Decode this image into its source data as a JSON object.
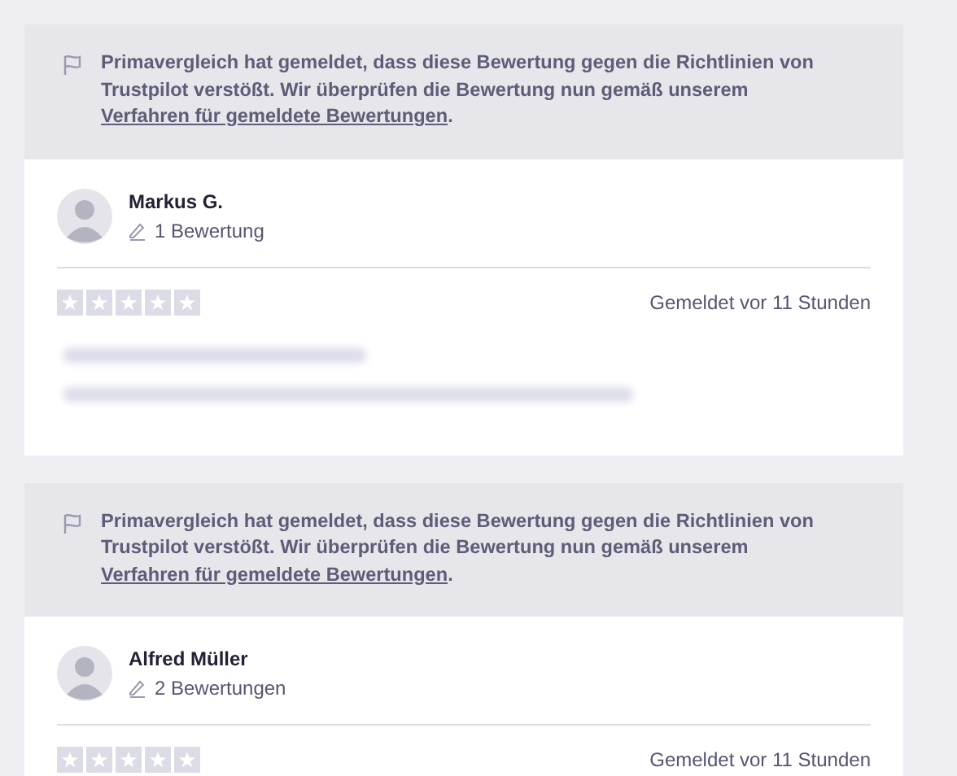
{
  "reviews": [
    {
      "notice": {
        "text": "Primavergleich hat gemeldet, dass diese Bewertung gegen die Richtlinien von Trustpilot verstößt. Wir überprüfen die Bewertung nun gemäß unserem ",
        "link": "Verfahren für gemeldete Bewertungen",
        "end": "."
      },
      "name": "Markus G.",
      "count": "1 Bewertung",
      "stars": 0,
      "date": "Gemeldet vor 11 Stunden",
      "blurred_body": true
    },
    {
      "notice": {
        "text": "Primavergleich hat gemeldet, dass diese Bewertung gegen die Richtlinien von Trustpilot verstößt. Wir überprüfen die Bewertung nun gemäß unserem ",
        "link": "Verfahren für gemeldete Bewertungen",
        "end": "."
      },
      "name": "Alfred Müller",
      "count": "2 Bewertungen",
      "stars": 0,
      "date": "Gemeldet vor 11 Stunden"
    }
  ]
}
